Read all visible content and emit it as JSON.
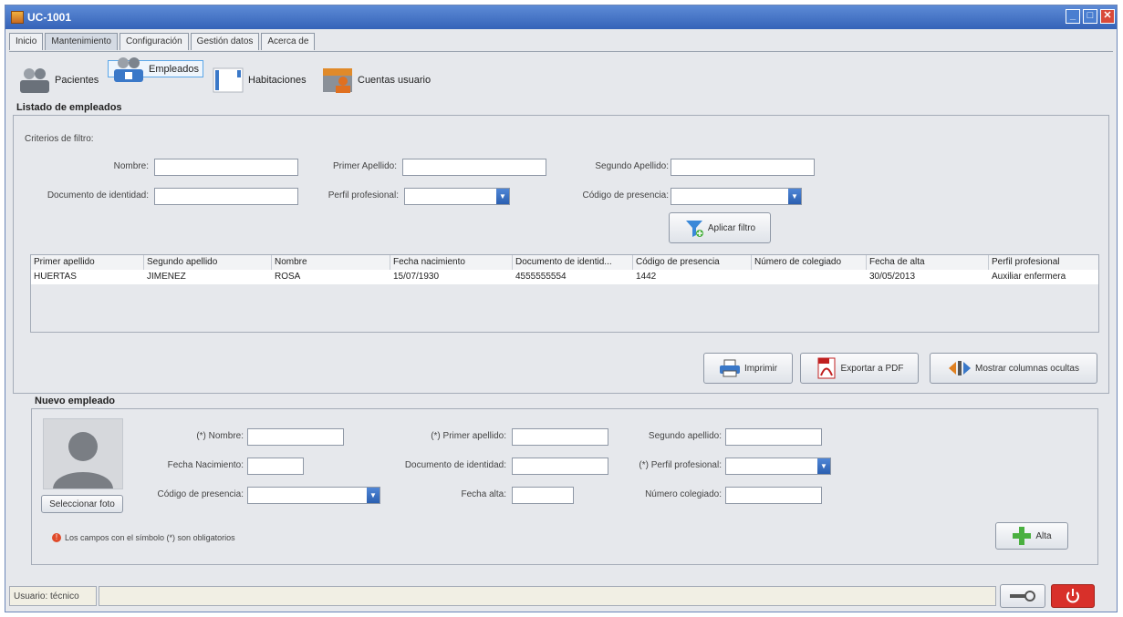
{
  "window": {
    "title": "UC-1001"
  },
  "tabs": [
    "Inicio",
    "Mantenimiento",
    "Configuración",
    "Gestión datos",
    "Acerca de"
  ],
  "toolbar": {
    "pacientes": "Pacientes",
    "empleados": "Empleados",
    "habitaciones": "Habitaciones",
    "cuentas": "Cuentas usuario"
  },
  "listado": {
    "title": "Listado de empleados",
    "criterios": "Criterios de filtro:",
    "nombre_label": "Nombre:",
    "apellido1_label": "Primer Apellido:",
    "apellido2_label": "Segundo Apellido:",
    "documento_label": "Documento de identidad:",
    "perfil_label": "Perfil profesional:",
    "codigo_label": "Código de presencia:",
    "aplicar_filtro": "Aplicar filtro"
  },
  "table": {
    "headers": [
      "Primer apellido",
      "Segundo apellido",
      "Nombre",
      "Fecha nacimiento",
      "Documento de identid...",
      "Código de presencia",
      "Número de colegiado",
      "Fecha de alta",
      "Perfil profesional"
    ],
    "rows": [
      [
        "HUERTAS",
        "JIMENEZ",
        "ROSA",
        "15/07/1930",
        "4555555554",
        "1442",
        "",
        "30/05/2013",
        "Auxiliar enfermera"
      ]
    ]
  },
  "actions": {
    "imprimir": "Imprimir",
    "exportar": "Exportar a PDF",
    "mostrar": "Mostrar columnas ocultas"
  },
  "nuevo": {
    "title": "Nuevo empleado",
    "seleccionar_foto": "Seleccionar foto",
    "nombre_label": "(*) Nombre:",
    "apellido1_label": "(*) Primer apellido:",
    "apellido2_label": "Segundo apellido:",
    "fecha_nac_label": "Fecha Nacimiento:",
    "documento_label": "Documento de identidad:",
    "perfil_label": "(*) Perfil profesional:",
    "codigo_label": "Código de presencia:",
    "fecha_alta_label": "Fecha alta:",
    "colegiado_label": "Número colegiado:",
    "obligatorios": "Los campos con el símbolo (*) son obligatorios",
    "alta": "Alta"
  },
  "status": {
    "user": "Usuario: técnico"
  },
  "colors": {
    "titlebar": "#3563b8",
    "accent": "#5aa6e8",
    "power": "#d8302a"
  },
  "icons": [
    "app-icon",
    "minimize-icon",
    "maximize-icon",
    "close-icon",
    "patients-icon",
    "employees-icon",
    "rooms-icon",
    "user-accounts-icon",
    "filter-icon",
    "printer-icon",
    "pdf-icon",
    "columns-icon",
    "avatar-icon",
    "warning-icon",
    "add-icon",
    "key-icon",
    "power-icon"
  ]
}
